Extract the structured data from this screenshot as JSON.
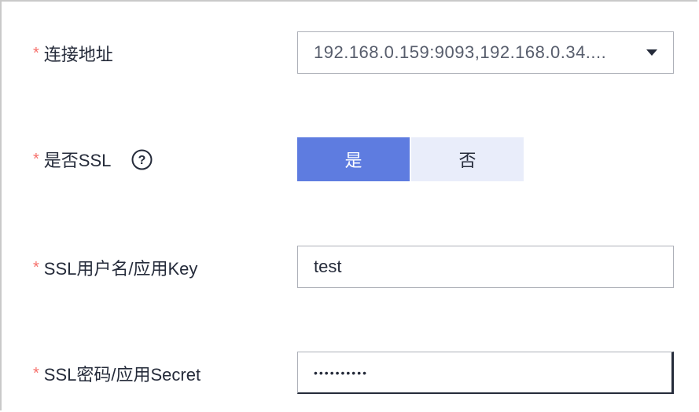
{
  "form": {
    "address": {
      "required_mark": "*",
      "label": "连接地址",
      "value": "192.168.0.159:9093,192.168.0.34....",
      "icon": "chevron-down-icon"
    },
    "ssl": {
      "required_mark": "*",
      "label": "是否SSL",
      "help_icon": "question-circle-icon",
      "help_glyph": "?",
      "options": [
        "是",
        "否"
      ],
      "selected": "是",
      "colors": {
        "active": "#5e7ce0",
        "inactive": "#e9edfa"
      }
    },
    "ssl_user": {
      "required_mark": "*",
      "label": "SSL用户名/应用Key",
      "value": "test"
    },
    "ssl_secret": {
      "required_mark": "*",
      "label": "SSL密码/应用Secret",
      "value": "••••••••••"
    }
  }
}
